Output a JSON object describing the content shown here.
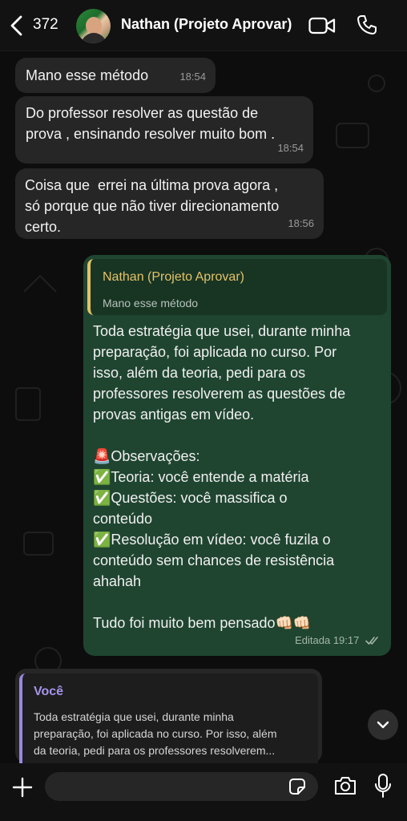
{
  "header": {
    "unread_count": "372",
    "contact_name": "Nathan (Projeto Aprovar)"
  },
  "messages": [
    {
      "text": "Mano esse método",
      "time": "18:54"
    },
    {
      "text": "Do professor resolver as questão de\nprova , ensinando resolver muito bom .",
      "time": "18:54"
    },
    {
      "text": "Coisa que  errei na última prova agora ,\nsó porque que não tiver direcionamento\ncerto.",
      "time": "18:56"
    }
  ],
  "outgoing": {
    "quote_author": "Nathan (Projeto Aprovar)",
    "quote_text": "Mano esse método",
    "text": "Toda estratégia que usei, durante minha\npreparação, foi aplicada no curso. Por\nisso, além da teoria, pedi para os\nprofessores resolverem as questões de\nprovas antigas em vídeo.\n\n🚨Observações:\n✅Teoria: você entende a matéria\n✅Questões: você massifica o\nconteúdo\n✅Resolução em vídeo: você fuzila o\nconteúdo sem chances de resistência\nahahah\n\nTudo foi muito bem pensado👊🏻👊🏻",
    "edited_label": "Editada",
    "time": "19:17"
  },
  "reply_preview": {
    "author": "Você",
    "text": "Toda estratégia que usei, durante minha\npreparação, foi aplicada no curso. Por isso, além\nda teoria, pedi para os professores resolverem..."
  },
  "composer": {
    "placeholder": ""
  },
  "colors": {
    "outgoing_bubble": "#1f4530",
    "incoming_bubble": "#262626",
    "quote_accent": "#e4c265",
    "you_accent": "#9b87e0"
  },
  "icons": [
    "chevron-left-icon",
    "video-camera-icon",
    "phone-icon",
    "chevron-down-icon",
    "plus-icon",
    "sticker-icon",
    "camera-icon",
    "microphone-icon",
    "double-check-icon"
  ]
}
